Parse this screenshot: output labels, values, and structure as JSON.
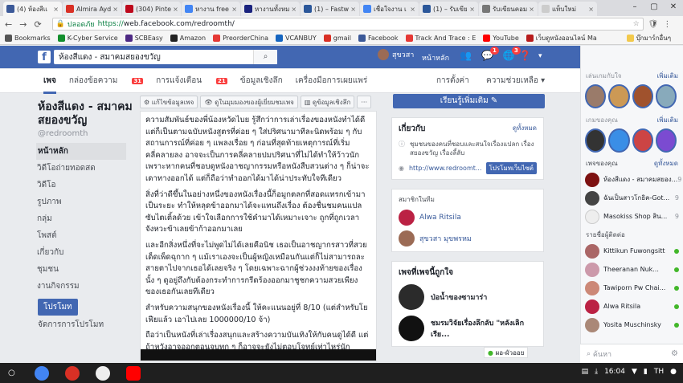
{
  "browser": {
    "tabs": [
      {
        "label": "(4) ห้องสีแ",
        "color": "#3b5998",
        "active": true
      },
      {
        "label": "Almira Ayd",
        "color": "#d93025"
      },
      {
        "label": "(304) Pinte",
        "color": "#bd081c"
      },
      {
        "label": "หางาน free",
        "color": "#4285f4"
      },
      {
        "label": "หางานทั้งหม",
        "color": "#1a237e"
      },
      {
        "label": "(1) – Fastw",
        "color": "#2b579a"
      },
      {
        "label": "เชื่อใจงาน เ",
        "color": "#4285f4"
      },
      {
        "label": "(1) – รับเขีย",
        "color": "#2b579a"
      },
      {
        "label": "รับเขียนคอม",
        "color": "#777777"
      },
      {
        "label": "แท็บใหม่",
        "color": "#cccccc"
      }
    ],
    "omnibox": {
      "secure_label": "ปลอดภัย",
      "scheme": "https://",
      "url": "web.facebook.com/redroomth/"
    },
    "bookmarks": [
      {
        "label": "Bookmarks",
        "color": "#555555"
      },
      {
        "label": "K-Cyber Service",
        "color": "#138f2d"
      },
      {
        "label": "SCBEasy",
        "color": "#4e2a84"
      },
      {
        "label": "Amazon",
        "color": "#222222"
      },
      {
        "label": "PreorderChina",
        "color": "#e53935"
      },
      {
        "label": "VCANBUY",
        "color": "#1565c0"
      },
      {
        "label": "gmail",
        "color": "#d93025"
      },
      {
        "label": "Facebook",
        "color": "#3b5998"
      },
      {
        "label": "Track And Trace : E",
        "color": "#e53935"
      },
      {
        "label": "YouTube",
        "color": "#ff0000"
      },
      {
        "label": "เว็บดูหนังออนไลน์ Ma",
        "color": "#b71c1c"
      }
    ],
    "bookmarks_right": "บุ๊กมาร์กอื่นๆ"
  },
  "fb": {
    "search_value": "ห้องสีแดง - สมาคมสยองขวัญ",
    "user_name": "สุขวสา",
    "home_label": "หน้าหลัก",
    "notif_badges": [
      "1",
      "3"
    ],
    "page_nav": {
      "home": "เพจ",
      "inbox": "กล่องข้อความ",
      "inbox_count": "31",
      "notifications": "การแจ้งเตือน",
      "notif_count": "21",
      "insights": "ข้อมูลเชิงลึก",
      "publishing": "เครื่องมือการเผยแพร่",
      "settings": "การตั้งค่า",
      "help": "ความช่วยเหลือ ▾"
    }
  },
  "page": {
    "name": "ห้องสีแดง - สมาคมสยองขวัญ",
    "handle": "@redroomth",
    "nav": [
      "หน้าหลัก",
      "วิดีโอถ่ายทอดสด",
      "วิดีโอ",
      "รูปภาพ",
      "กลุ่ม",
      "โพสต์",
      "เกี่ยวกับ",
      "ชุมชน",
      "งานกิจกรรม"
    ],
    "promote": "โปรโมท",
    "manage_promotions": "จัดการการโปรโมท"
  },
  "actions": [
    "แก้ไขข้อมูลเพจ",
    "ดูในมุมมองของผู้เยี่ยมชมเพจ",
    "ดูข้อมูลเชิงลึก",
    "···"
  ],
  "post": {
    "paragraphs": [
      "ความสัมพันธ์ของพี่น้องหวัดไบย รู้สึกว่าการเล่าเรื่องของหนังทำได้ดีแต่ก็เป็นตามฉบับหนังสูตรที่ค่อย ๆ ใส่ปริศนามาทีละนิดพร้อม ๆ กับสถานการณ์ที่ค่อย ๆ แพลงเรื่อย ๆ ก่อนที่สุดท้ายเหตุการณ์ที่เริ่มคลี่คลายลง อาจจะเป็นการคลี่คลายปมปริศนาที่ไม่ได้ทำให้ว้าวนัก เพราะหากคนที่ชอบดูหนังอาชญากรรมหรือหนังสืบสวนต่าง ๆ ก็น่าจะเดาทางออกได้ แต่ก็ถือว่าทำออกได้มาได้น่าประทับใจทีเดียว",
      "สิ่งที่ว่าดีขึ้นในอย่างหนึ่งของหนังเรื่องนี้ก็อมูกตลกที่สอดแทรกเข้ามาเป็นระยะ ทำให้หลุดข้าออกมาได้จะแทนถึงเรื่อง ต้องชื่นชมคนแปลซับไตเติ้ลด้วย เข้าใจเลือกการใช้คำมาได้เหมาะเจาะ ถูกที่ถูกเวลา จังหวะข้าเลยข้าก้าออกมาเลย",
      "และอีกสิ่งหนึ่งที่จะไม่พูดไม่ได้เลยคือนิช เธอเป็นอาชญากรสาวที่สวยเด็ดเพ็ดฉุกาก ๆ แม้เราเองจะเป็นผู้หญิงเหมือนกันแต่ก็ไม่สามารถละสายตาไปจากเธอได้เลยจริง ๆ โดยเฉพาะฉากผู้ช่วงงงท้ายของเรื่อง นั้ง ๆ ดูอยู่ถึงกับต้องกระทำการกรีดร้องออกมาชูชกความสวยเพียงของเธอกันเลยทีเดียว",
      "สำหรับความสนุกของหนังเรื่องนี้ ให้คะแนนอยู่ที่ 8/10 (แต่สำหรับโยเฟียแล้ว เอาไปเลย 1000000/10 จ้า)",
      "ถือว่าเป็นหนังที่เล่าเรื่องสนุกและสร้างความบันเทิงให้กับคนดูได้ดี แต่ถ้าหวังอาจออกตอนจบทุก ๆ ก็อาจจะยังไม่ตอบโจทย์เท่าไหร่นัก แต่!!!จากเอคชั่นในเรื่องนี้ก็เจ๋งพอตัวอยู่นะ"
    ]
  },
  "right": {
    "like_button": "เรียนรู้เพิ่มเติม ✎",
    "about": {
      "title": "เกี่ยวกับ",
      "see_all": "ดูทั้งหมด",
      "desc": "ชุมชนของคนที่ชอบและสนใจเรื่องแปลก เรื่องสยองขวัญ เรื่องลี้ลับ",
      "url": "http://www.redroomt...",
      "site_button": "โปรโมทเว็บไซต์"
    },
    "members": {
      "title": "สมาชิกในทีม",
      "items": [
        "Alwa Ritsila",
        "สุขวสา มุขพรหม"
      ]
    },
    "liked_pages": {
      "title": "เพจที่เพจนี้ถูกใจ",
      "items": [
        "ป่อน้ำของซามาร่า",
        "ชมรมวิจัยเรื่องลึกลับ \"หลังเลิกเรีย..."
      ]
    }
  },
  "sidebar": {
    "stories_title": "เล่นเกมกับใจ",
    "stories_more": "เพิ่มเติม",
    "stories_title2": "เกมของคุณ",
    "stories_more2": "เพิ่มเติม",
    "pages_title": "เพจของคุณ",
    "pages_more": "ดูทั้งหมด",
    "pages": [
      {
        "label": "ห้องสีแดง - สมาคมสยอง...",
        "count": "9"
      },
      {
        "label": "ฉันเป็นสาวโกธิค-Got...",
        "count": "9"
      },
      {
        "label": "Masokiss Shop สิน...",
        "count": "9"
      }
    ],
    "contacts_title": "รายชื่อผู้ติดต่อ",
    "contacts": [
      "Kittikun Fuwongsitt",
      "Theeranan Nuk...",
      "Tawiporn Pw Chai...",
      "Alwa Ritsila",
      "Yosita Muschinsky"
    ],
    "search_placeholder": "ค้นหา"
  },
  "chat_pill": "ผอ-ผัวออย",
  "taskbar": {
    "time": "16:04",
    "lang": "TH"
  },
  "colors": {
    "fb_blue": "#4267b2",
    "badge_red": "#fa3e3e",
    "online_green": "#42b72a"
  }
}
